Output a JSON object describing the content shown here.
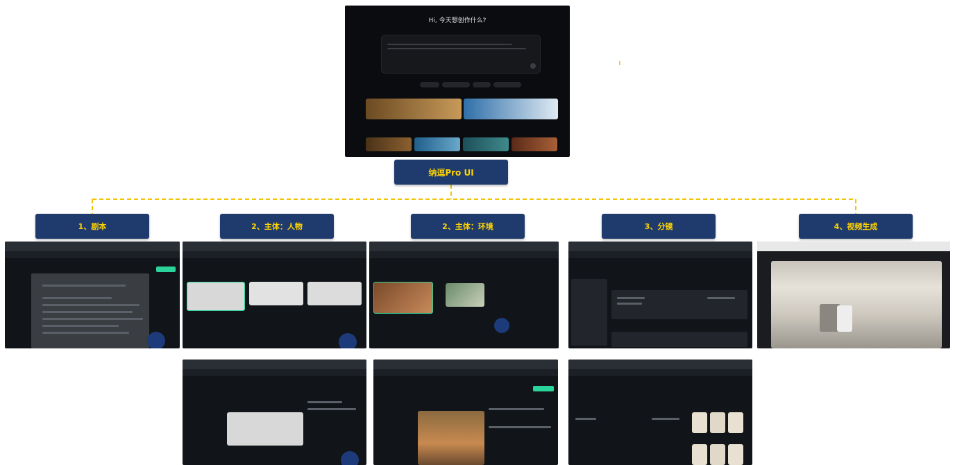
{
  "root": {
    "label": "纳逗Pro UI"
  },
  "hero": {
    "greeting": "Hi, 今天想创作什么?"
  },
  "steps": [
    {
      "label": "1、剧本"
    },
    {
      "label": "2、主体：人物"
    },
    {
      "label": "2、主体：环境"
    },
    {
      "label": "3、分镜"
    },
    {
      "label": "4、视频生成"
    }
  ],
  "colors": {
    "box_fill": "#1f3b6e",
    "box_text": "#ffd400",
    "connector": "#f2c500"
  }
}
